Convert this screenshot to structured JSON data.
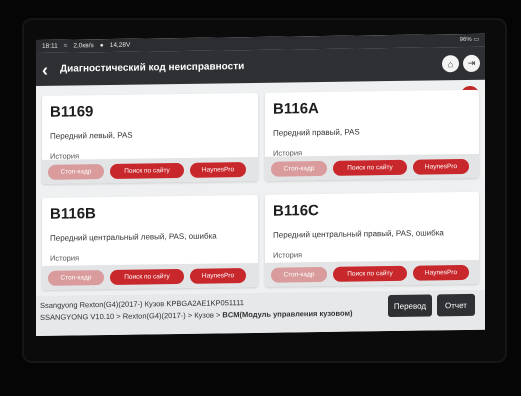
{
  "status": {
    "time": "18:11",
    "speed": "2,0кв/s",
    "voltage": "14,28V",
    "battery": "96%"
  },
  "header": {
    "title": "Диагностический код неисправности",
    "back_icon": "chevron-left-icon",
    "home_icon": "home-icon",
    "exit_icon": "exit-icon",
    "camera_icon": "camera-icon"
  },
  "cards": [
    {
      "code": "B1169",
      "description": "Передний левый, PAS",
      "history": "История",
      "buttons": {
        "freeze": "Стоп-кадр",
        "search": "Поиск по сайту",
        "haynes": "HaynesPro"
      }
    },
    {
      "code": "B116A",
      "description": "Передний правый, PAS",
      "history": "История",
      "buttons": {
        "freeze": "Стоп-кадр",
        "search": "Поиск по сайту",
        "haynes": "HaynesPro"
      }
    },
    {
      "code": "B116B",
      "description": "Передний центральный левый, PAS, ошибка",
      "history": "История",
      "buttons": {
        "freeze": "Стоп-кадр",
        "search": "Поиск по сайту",
        "haynes": "HaynesPro"
      }
    },
    {
      "code": "B116C",
      "description": "Передний центральный правый, PAS, ошибка",
      "history": "История",
      "buttons": {
        "freeze": "Стоп-кадр",
        "search": "Поиск по сайту",
        "haynes": "HaynesPro"
      }
    }
  ],
  "footer": {
    "line1": "Ssangyong  Rexton(G4)(2017-)  Кузов  KPBGA2AE1KP051111",
    "line2_prefix": "SSANGYONG V10.10 > Rexton(G4)(2017-) > Кузов > ",
    "line2_bold": "BCM(Модуль управления кузовом)",
    "translate": "Перевод",
    "report": "Отчет"
  },
  "colors": {
    "accent": "#c8282c",
    "accent_dim": "#d99b9b",
    "header_bg": "#2e3034"
  }
}
